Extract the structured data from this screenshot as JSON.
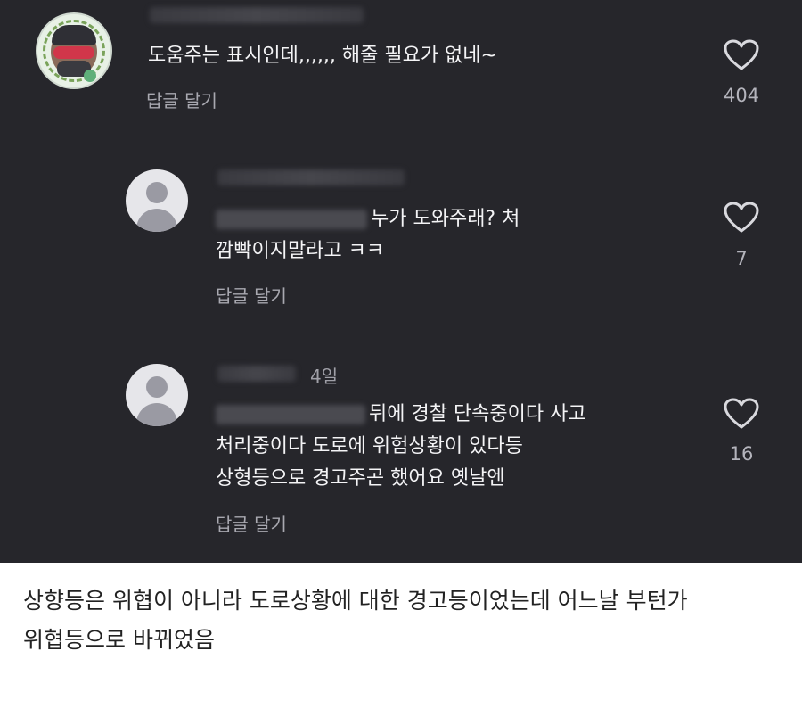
{
  "comments": [
    {
      "text_lines": [
        "도움주는 표시인데,,,,,, 해줄 필요가 없네~"
      ],
      "reply_label": "답글 달기",
      "likes": "404",
      "avatar": "profile-climate-action-avatar"
    },
    {
      "text_lines": [
        "누가 도와주래? 쳐",
        "깜빡이지말라고 ㅋㅋ"
      ],
      "reply_label": "답글 달기",
      "likes": "7",
      "avatar": "default-user-avatar"
    },
    {
      "timestamp": "4일",
      "text_lines": [
        "뒤에 경찰 단속중이다 사고",
        "처리중이다 도로에 위험상황이 있다등",
        "상형등으로 경고주곤 했어요 옛날엔"
      ],
      "reply_label": "답글 달기",
      "likes": "16",
      "avatar": "default-user-avatar"
    }
  ],
  "caption_lines": [
    "상향등은 위협이 아니라 도로상황에 대한 경고등이었는데 어느날 부턴가",
    "위협등으로 바뀌었음"
  ],
  "colors": {
    "dark_background": "#26262b",
    "caption_background": "#ffffff",
    "text_primary": "#f4f4f6",
    "text_secondary": "#a8a8b0"
  },
  "icons": [
    "heart-outline-icon"
  ]
}
